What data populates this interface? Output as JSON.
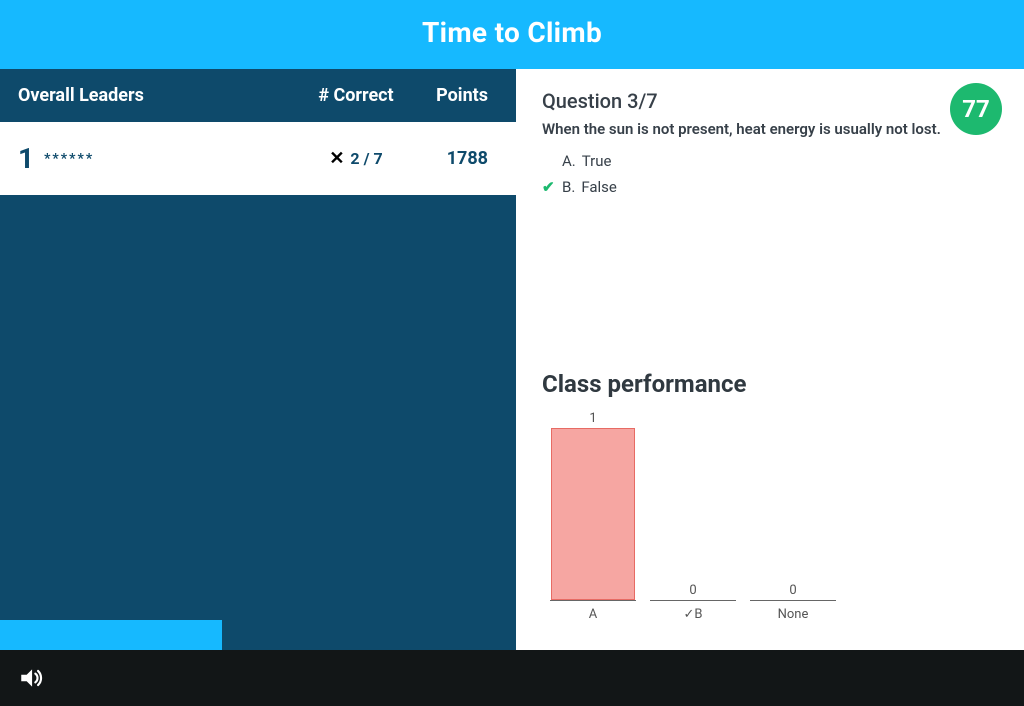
{
  "header": {
    "title": "Time to Climb"
  },
  "leaderboard": {
    "title": "Overall Leaders",
    "col_correct": "# Correct",
    "col_points": "Points",
    "rows": [
      {
        "rank": "1",
        "name": "******",
        "correct": "2 / 7",
        "points": "1788",
        "last_wrong": true
      }
    ],
    "progress_pct": 43
  },
  "question": {
    "number_label": "Question 3/7",
    "text": "When the sun is not present, heat energy is usually not lost.",
    "options": [
      {
        "letter": "A.",
        "text": "True",
        "correct": false
      },
      {
        "letter": "B.",
        "text": "False",
        "correct": true
      }
    ]
  },
  "score_badge": "77",
  "class_perf": {
    "title": "Class performance"
  },
  "chart_data": {
    "type": "bar",
    "title": "Class performance",
    "categories": [
      "A",
      "✓B",
      "None"
    ],
    "values": [
      1,
      0,
      0
    ],
    "ylim": [
      0,
      1
    ],
    "xlabel": "",
    "ylabel": ""
  }
}
